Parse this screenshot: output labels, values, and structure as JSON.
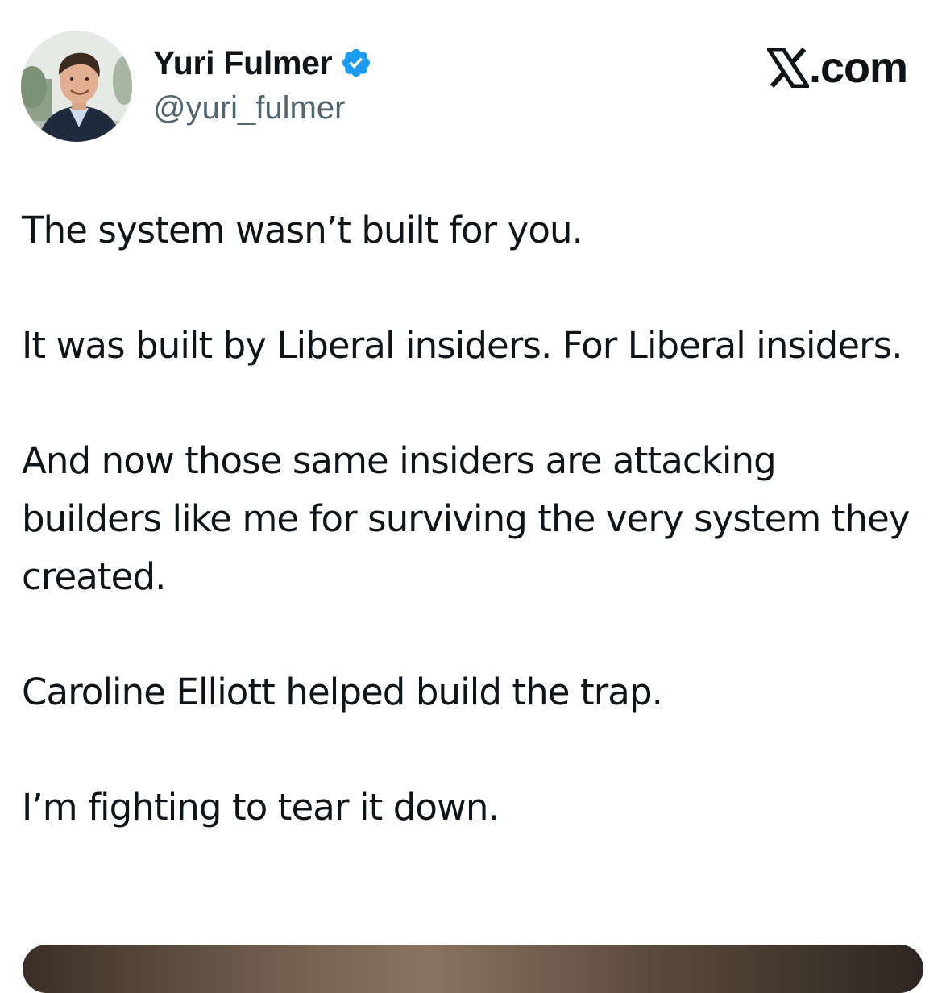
{
  "author": {
    "display_name": "Yuri Fulmer",
    "handle": "@yuri_fulmer",
    "verified": true,
    "avatar_icon": "profile-photo",
    "verified_icon": "verified-badge-icon",
    "verified_color": "#1d9bf0"
  },
  "brand": {
    "label": ".com",
    "logo_icon": "x-logo-icon"
  },
  "tweet": {
    "paragraphs": [
      "The system wasn’t built for you.",
      "It was built by Liberal insiders. For Liberal insiders.",
      "And now those same insiders are attacking builders like me for surviving the very system they created.",
      "Caroline Elliott helped build the trap.",
      "I’m fighting to tear it down."
    ]
  },
  "colors": {
    "text": "#0f1419",
    "secondary_text": "#536471",
    "background": "#ffffff"
  }
}
